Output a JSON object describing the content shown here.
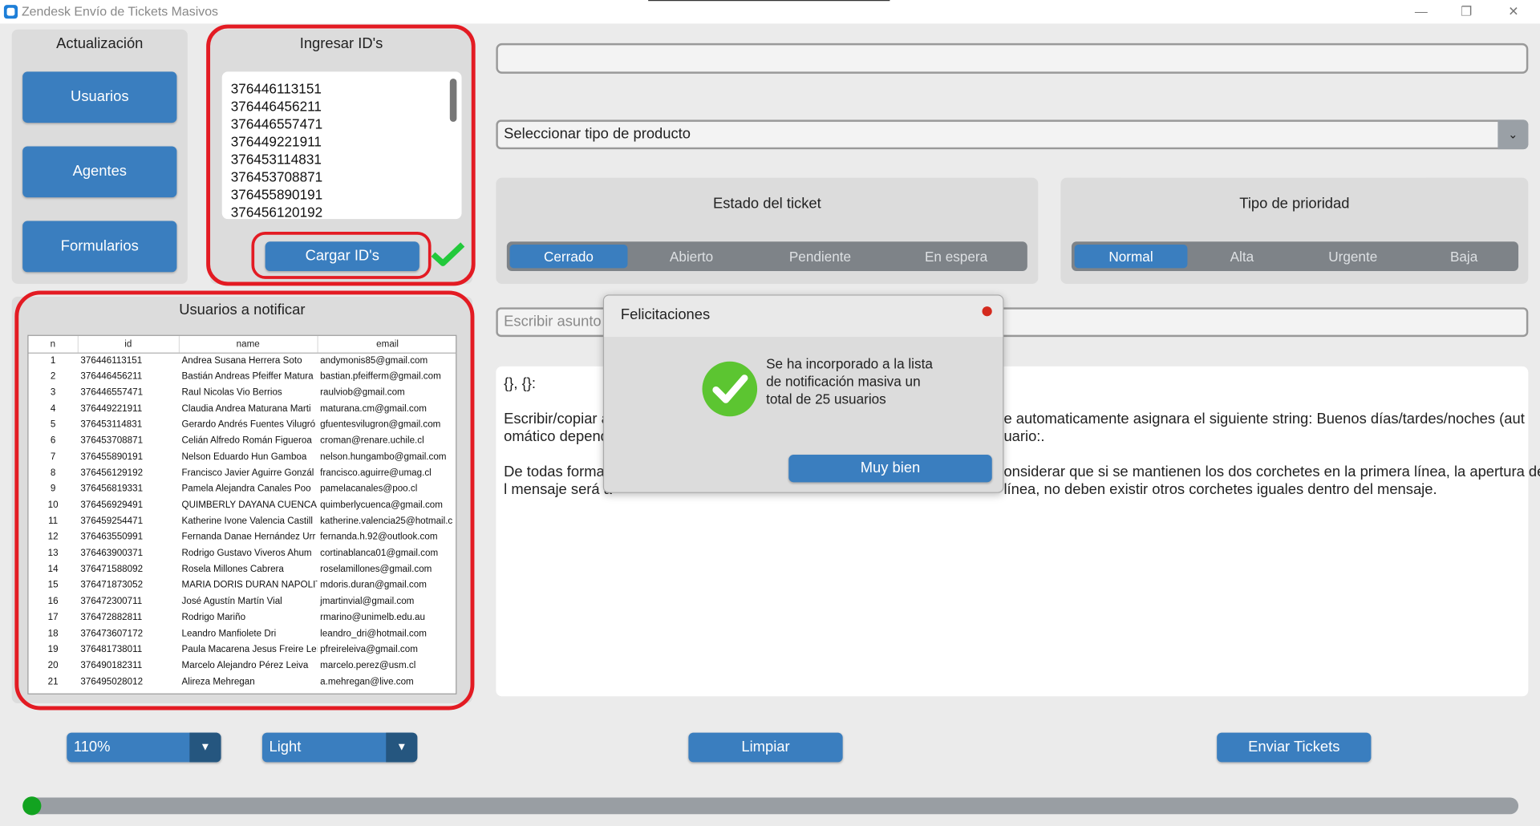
{
  "window": {
    "title": "Zendesk Envío de Tickets Masivos",
    "minimize_icon": "minimize-icon",
    "maximize_icon": "restore-icon",
    "close_icon": "close-icon"
  },
  "update_panel": {
    "title": "Actualización",
    "buttons": [
      "Usuarios",
      "Agentes",
      "Formularios"
    ]
  },
  "ids_panel": {
    "title": "Ingresar ID's",
    "ids": [
      "376446113151",
      "376446456211",
      "376446557471",
      "376449221911",
      "376453114831",
      "376453708871",
      "376455890191",
      "376456120192"
    ],
    "load_button": "Cargar ID's",
    "status_icon": "check-icon",
    "status_color": "#22c93b"
  },
  "users_panel": {
    "title": "Usuarios a notificar",
    "columns": [
      "n",
      "id",
      "name",
      "email"
    ],
    "rows": [
      [
        "1",
        "376446113151",
        "Andrea Susana Herrera Soto",
        "andymonis85@gmail.com"
      ],
      [
        "2",
        "376446456211",
        "Bastián Andreas Pfeiffer Matura",
        "bastian.pfeifferm@gmail.com"
      ],
      [
        "3",
        "376446557471",
        "Raul Nicolas Vio Berrios",
        "raulviob@gmail.com"
      ],
      [
        "4",
        "376449221911",
        "Claudia Andrea Maturana Marti",
        "maturana.cm@gmail.com"
      ],
      [
        "5",
        "376453114831",
        "Gerardo Andrés Fuentes Vilugró",
        "gfuentesvilugron@gmail.com"
      ],
      [
        "6",
        "376453708871",
        "Celián Alfredo Román Figueroa",
        "croman@renare.uchile.cl"
      ],
      [
        "7",
        "376455890191",
        "Nelson Eduardo Hun Gamboa",
        "nelson.hungambo@gmail.com"
      ],
      [
        "8",
        "376456129192",
        "Francisco Javier Aguirre Gonzál",
        "francisco.aguirre@umag.cl"
      ],
      [
        "9",
        "376456819331",
        "Pamela Alejandra Canales Poo",
        "pamelacanales@poo.cl"
      ],
      [
        "10",
        "376456929491",
        "QUIMBERLY DAYANA CUENCA",
        "quimberlycuenca@gmail.com"
      ],
      [
        "11",
        "376459254471",
        "Katherine Ivone Valencia Castill",
        "katherine.valencia25@hotmail.c"
      ],
      [
        "12",
        "376463550991",
        "Fernanda Danae Hernández Urr",
        "fernanda.h.92@outlook.com"
      ],
      [
        "13",
        "376463900371",
        "Rodrigo Gustavo Viveros Ahum",
        "cortinablanca01@gmail.com"
      ],
      [
        "14",
        "376471588092",
        "Rosela Millones Cabrera",
        "roselamillones@gmail.com"
      ],
      [
        "15",
        "376471873052",
        "MARIA DORIS DURAN NAPOLIT",
        "mdoris.duran@gmail.com"
      ],
      [
        "16",
        "376472300711",
        "José Agustín Martín Vial",
        "jmartinvial@gmail.com"
      ],
      [
        "17",
        "376472882811",
        "Rodrigo Mariño",
        "rmarino@unimelb.edu.au"
      ],
      [
        "18",
        "376473607172",
        "Leandro Manfiolete Dri",
        "leandro_dri@hotmail.com"
      ],
      [
        "19",
        "376481738011",
        "Paula Macarena Jesus Freire Lei",
        "pfreireleiva@gmail.com"
      ],
      [
        "20",
        "376490182311",
        "Marcelo Alejandro Pérez Leiva",
        "marcelo.perez@usm.cl"
      ],
      [
        "21",
        "376495028012",
        "Alireza Mehregan",
        "a.mehregan@live.com"
      ]
    ]
  },
  "top_input": {
    "value": ""
  },
  "product_select": {
    "selected": "Seleccionar tipo de producto",
    "icon": "chevron-down-icon"
  },
  "ticket_state": {
    "title": "Estado del ticket",
    "options": [
      "Cerrado",
      "Abierto",
      "Pendiente",
      "En espera"
    ],
    "selected": "Cerrado"
  },
  "priority": {
    "title": "Tipo de prioridad",
    "options": [
      "Normal",
      "Alta",
      "Urgente",
      "Baja"
    ],
    "selected": "Normal"
  },
  "subject_input": {
    "placeholder": "Escribir asunto d",
    "value": ""
  },
  "message": {
    "line1": "{}, {}:",
    "p2_left": "Escribir/copiar a",
    "p2_right": "e automaticamente asignara el siguiente string: Buenos días/tardes/noches (aut",
    "p2_left_2": "omático depend",
    "p2_right_2": "uario:.",
    "p3_left": "De todas forma",
    "p3_right": "onsiderar que si se mantienen los dos corchetes en la primera línea, la apertura de",
    "p3_left_2": "l mensaje será a",
    "p3_right_2": "línea, no deben existir otros corchetes iguales dentro del mensaje."
  },
  "dialog": {
    "title": "Felicitaciones",
    "message": "Se ha incorporado a la lista de notificación masiva un total de 25 usuarios",
    "button": "Muy bien",
    "icon": "check-circle-icon",
    "icon_color": "#5cc531",
    "dot_color": "#d42a1e"
  },
  "bottom": {
    "zoom": "110%",
    "theme": "Light",
    "clear_button": "Limpiar",
    "send_button": "Enviar Tickets"
  },
  "progress": {
    "value": 0.0
  }
}
